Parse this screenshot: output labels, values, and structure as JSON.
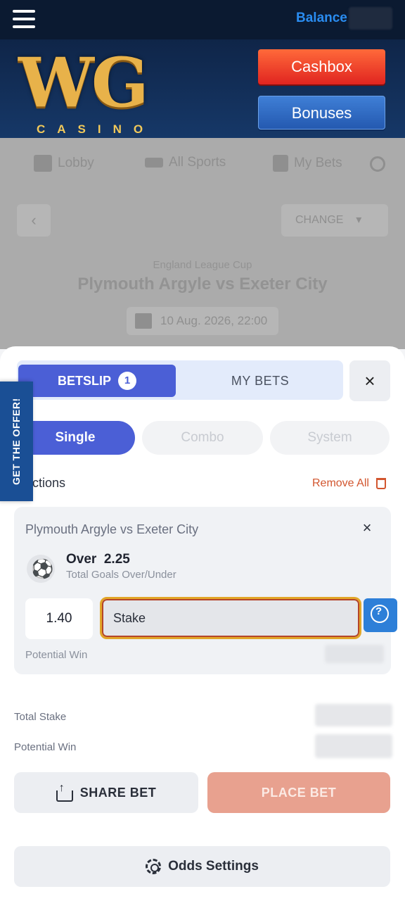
{
  "topbar": {
    "balance_label": "Balance"
  },
  "header": {
    "logo_letters": "WG",
    "logo_sub": "CASINO",
    "cashbox_label": "Cashbox",
    "bonuses_label": "Bonuses"
  },
  "background_page": {
    "nav": [
      "Lobby",
      "All Sports",
      "My Bets"
    ],
    "change_label": "CHANGE",
    "league": "England League Cup",
    "match": "Plymouth Argyle vs Exeter City",
    "date": "10 Aug. 2026, 22:00"
  },
  "betslip": {
    "tab_betslip": "BETSLIP",
    "tab_count": "1",
    "tab_mybets": "MY BETS",
    "close_icon": "×",
    "modes": [
      "Single",
      "Combo",
      "System"
    ],
    "selections_label": "ections",
    "remove_all": "Remove All",
    "get_offer": "GET THE OFFER!",
    "selection": {
      "match": "Plymouth Argyle vs Exeter City",
      "outcome": "Over  2.25",
      "market": "Total Goals Over/Under",
      "odds": "1.40",
      "stake_placeholder": "Stake",
      "potential_win_label": "Potential Win"
    },
    "total_stake_label": "Total Stake",
    "total_win_label": "Potential Win",
    "share_label": "SHARE BET",
    "place_label": "PLACE BET",
    "odds_settings_label": "Odds Settings"
  },
  "colors": {
    "accent": "#4b5fd6",
    "cashbox": "#e02420",
    "remove": "#d2562f",
    "place_bet_disabled": "#e8a18f"
  },
  "icons": [
    "hamburger-icon",
    "calendar-icon",
    "search-icon",
    "close-icon",
    "trash-icon",
    "soccer-ball-icon",
    "chat-help-icon",
    "share-icon",
    "gear-icon"
  ]
}
